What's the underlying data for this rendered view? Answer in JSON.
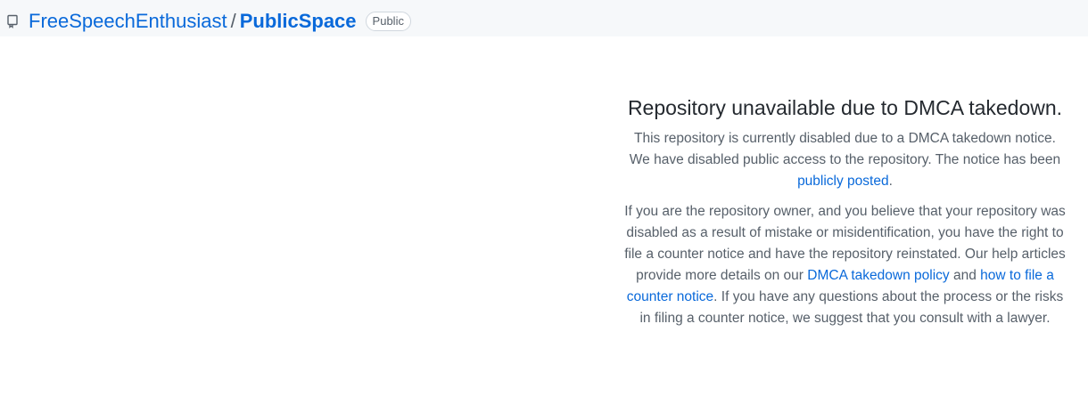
{
  "header": {
    "icon": "repo-icon",
    "owner": "FreeSpeechEnthusiast",
    "separator": "/",
    "repo": "PublicSpace",
    "visibility": "Public"
  },
  "notice": {
    "title": "Repository unavailable due to DMCA takedown.",
    "para1_text": "This repository is currently disabled due to a DMCA takedown notice. We have disabled public access to the repository. The notice has been ",
    "para1_link": "publicly posted",
    "para1_end": ".",
    "para2_text": "If you are the repository owner, and you believe that your repository was disabled as a result of mistake or misidentification, you have the right to file a counter notice and have the repository reinstated. Our help articles provide more details on our ",
    "para2_link1": "DMCA takedown policy",
    "para2_mid": " and ",
    "para2_link2": "how to file a counter notice",
    "para2_end": ". If you have any questions about the process or the risks in filing a counter notice, we suggest that you consult with a lawyer."
  },
  "colors": {
    "link": "#0969da",
    "header_bg": "#f6f8fa",
    "text_muted": "#57606a",
    "heading": "#24292f"
  }
}
